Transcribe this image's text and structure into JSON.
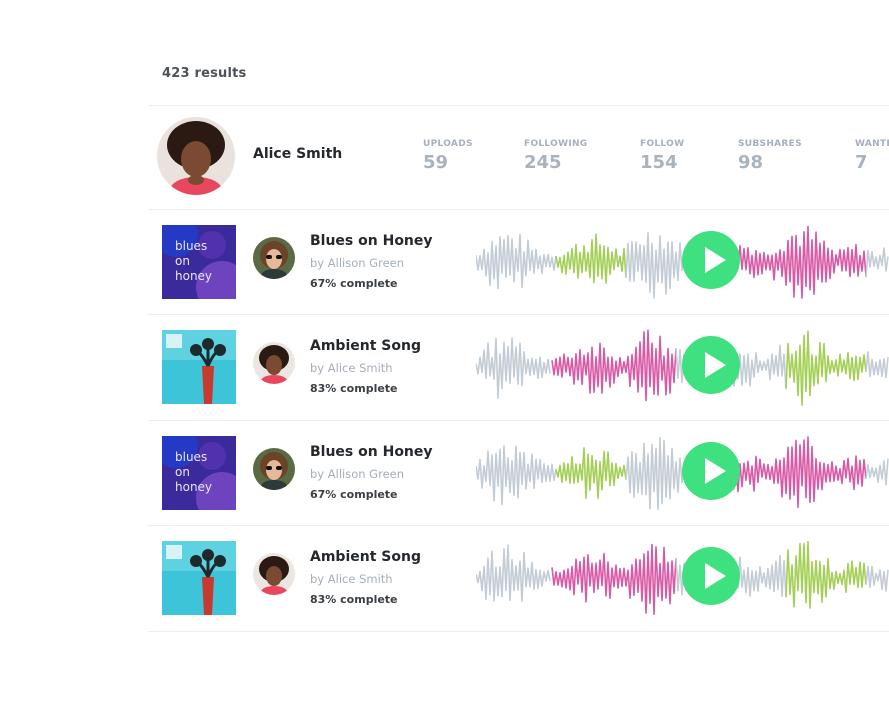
{
  "results": {
    "count_label": "423 results"
  },
  "profile": {
    "name": "Alice Smith",
    "stats": [
      {
        "label": "UPLOADS",
        "value": "59"
      },
      {
        "label": "FOLLOWING",
        "value": "245"
      },
      {
        "label": "FOLLOW",
        "value": "154"
      },
      {
        "label": "SUBSHARES",
        "value": "98"
      },
      {
        "label": "WANTED",
        "value": "7"
      }
    ]
  },
  "tracks": [
    {
      "title": "Blues on Honey",
      "artist": "by Allison Green",
      "progress": "67% complete",
      "cover_text": [
        "blues",
        "on",
        "honey"
      ],
      "cover_style": "blues",
      "avatar_style": "sunglasses"
    },
    {
      "title": "Ambient Song",
      "artist": "by Alice Smith",
      "progress": "83% complete",
      "cover_text": [],
      "cover_style": "ambient",
      "avatar_style": "alice"
    },
    {
      "title": "Blues on Honey",
      "artist": "by Allison Green",
      "progress": "67% complete",
      "cover_text": [
        "blues",
        "on",
        "honey"
      ],
      "cover_style": "blues",
      "avatar_style": "sunglasses"
    },
    {
      "title": "Ambient Song",
      "artist": "by Alice Smith",
      "progress": "83% complete",
      "cover_text": [],
      "cover_style": "ambient",
      "avatar_style": "alice"
    }
  ],
  "colors": {
    "play_button": "#3ee080",
    "wave_gray": "#c3ccd4",
    "wave_green": "#a4cf57",
    "wave_pink": "#d85aa6"
  },
  "icons": {
    "play": "play-icon"
  }
}
